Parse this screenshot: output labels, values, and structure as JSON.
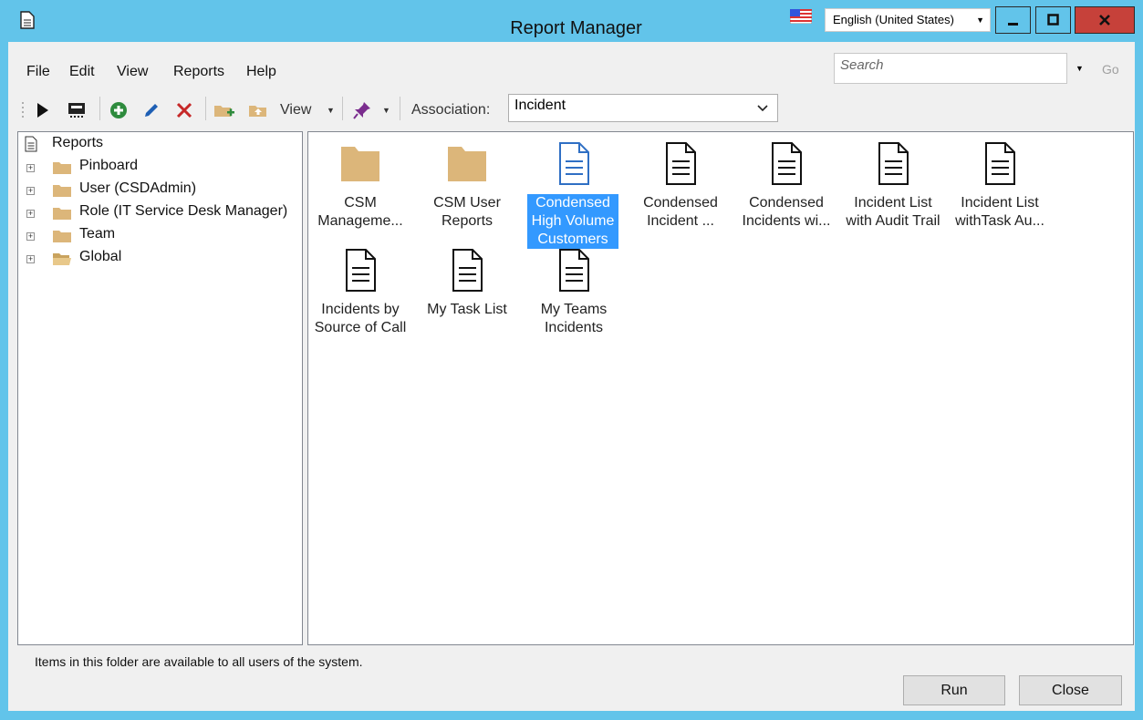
{
  "window": {
    "title": "Report Manager",
    "language": "English (United States)",
    "colors": {
      "title_bar": "#62c4ea",
      "close_button": "#c6413a",
      "selection": "#3399ff",
      "folder": "#dcb67a"
    }
  },
  "menu": {
    "file": "File",
    "edit": "Edit",
    "view": "View",
    "reports": "Reports",
    "help": "Help"
  },
  "search": {
    "placeholder": "Search",
    "go_label": "Go"
  },
  "toolbar": {
    "view_label": "View",
    "association_label": "Association:",
    "association_value": "Incident",
    "icons": [
      "run-icon",
      "run-on-dashboard-icon",
      "add-icon",
      "edit-icon",
      "delete-icon",
      "new-folder-icon",
      "up-folder-icon",
      "pin-icon"
    ]
  },
  "tree": {
    "root": "Reports",
    "items": [
      {
        "label": "Pinboard"
      },
      {
        "label": "User (CSDAdmin)"
      },
      {
        "label": "Role (IT Service Desk Manager)"
      },
      {
        "label": "Team"
      },
      {
        "label": "Global"
      }
    ]
  },
  "items": [
    {
      "line1": "CSM",
      "line2": "Manageme...",
      "line3": "",
      "type": "folder"
    },
    {
      "line1": "CSM User",
      "line2": "Reports",
      "line3": "",
      "type": "folder"
    },
    {
      "line1": "Condensed",
      "line2": "High Volume",
      "line3": "Customers",
      "type": "report",
      "selected": true
    },
    {
      "line1": "Condensed",
      "line2": "Incident ...",
      "line3": "",
      "type": "report"
    },
    {
      "line1": "Condensed",
      "line2": "Incidents wi...",
      "line3": "",
      "type": "report"
    },
    {
      "line1": "Incident List",
      "line2": "with Audit Trail",
      "line3": "",
      "type": "report"
    },
    {
      "line1": "Incident List",
      "line2": "withTask Au...",
      "line3": "",
      "type": "report"
    },
    {
      "line1": "Incidents by",
      "line2": "Source of Call",
      "line3": "",
      "type": "report"
    },
    {
      "line1": "My Task List",
      "line2": "",
      "line3": "",
      "type": "report"
    },
    {
      "line1": "My Teams",
      "line2": "Incidents",
      "line3": "",
      "type": "report"
    }
  ],
  "status": "Items in this folder are available to all users of the system.",
  "buttons": {
    "run": "Run",
    "close": "Close"
  }
}
